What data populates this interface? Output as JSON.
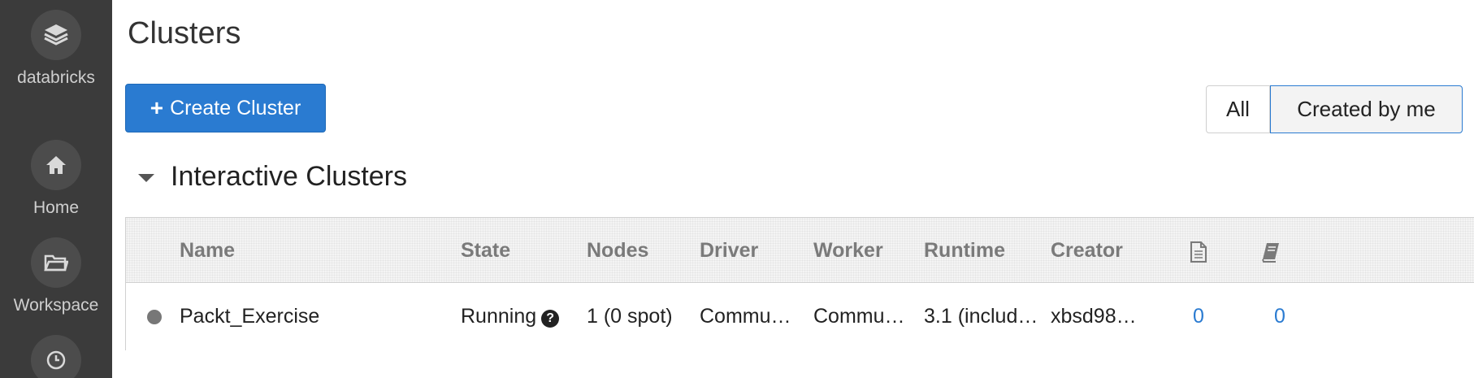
{
  "sidebar": {
    "logo_label": "databricks",
    "items": [
      {
        "label": "Home",
        "icon": "home-icon"
      },
      {
        "label": "Workspace",
        "icon": "folder-icon"
      },
      {
        "label": "",
        "icon": "clock-icon"
      }
    ]
  },
  "page": {
    "title": "Clusters",
    "create_button": "Create Cluster",
    "filters": {
      "all": "All",
      "mine": "Created by me",
      "active": "mine"
    },
    "section_title": "Interactive Clusters"
  },
  "table": {
    "columns": [
      "Name",
      "State",
      "Nodes",
      "Driver",
      "Worker",
      "Runtime",
      "Creator"
    ],
    "icon_columns": [
      "document-icon",
      "notebook-icon"
    ],
    "rows": [
      {
        "name": "Packt_Exercise",
        "state": "Running",
        "nodes": "1 (0 spot)",
        "driver": "Commu…",
        "worker": "Commu…",
        "runtime": "3.1 (includ…",
        "creator": "xbsd98…",
        "col_a": "0",
        "col_b": "0"
      }
    ]
  },
  "colors": {
    "sidebar_bg": "#3b3b3b",
    "accent": "#2a7bd1",
    "status_stopped_gray": "#777777"
  }
}
